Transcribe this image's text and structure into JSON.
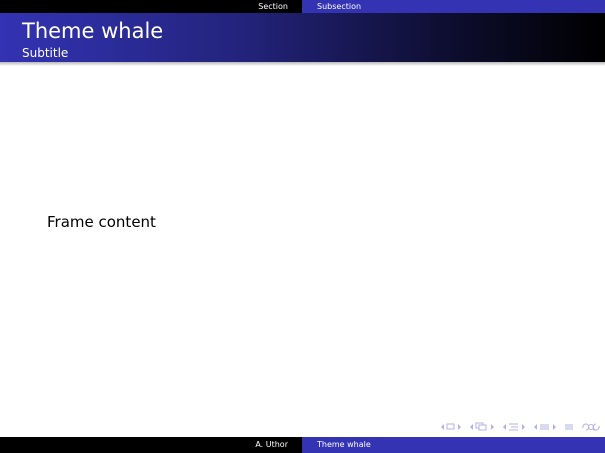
{
  "headline": {
    "section": "Section",
    "subsection": "Subsection"
  },
  "frame": {
    "title": "Theme whale",
    "subtitle": "Subtitle",
    "content": "Frame content"
  },
  "footline": {
    "author": "A. Uthor",
    "short_title": "Theme whale"
  },
  "navigation": {
    "icons": [
      "nav-frame-icon",
      "nav-subsection-icon",
      "nav-section-icon",
      "nav-document-icon",
      "nav-appendix-icon",
      "nav-search-icon"
    ],
    "color": "#b3b3e0"
  },
  "colors": {
    "structure": "#3333b3",
    "dark": "#000000",
    "background": "#ffffff"
  }
}
